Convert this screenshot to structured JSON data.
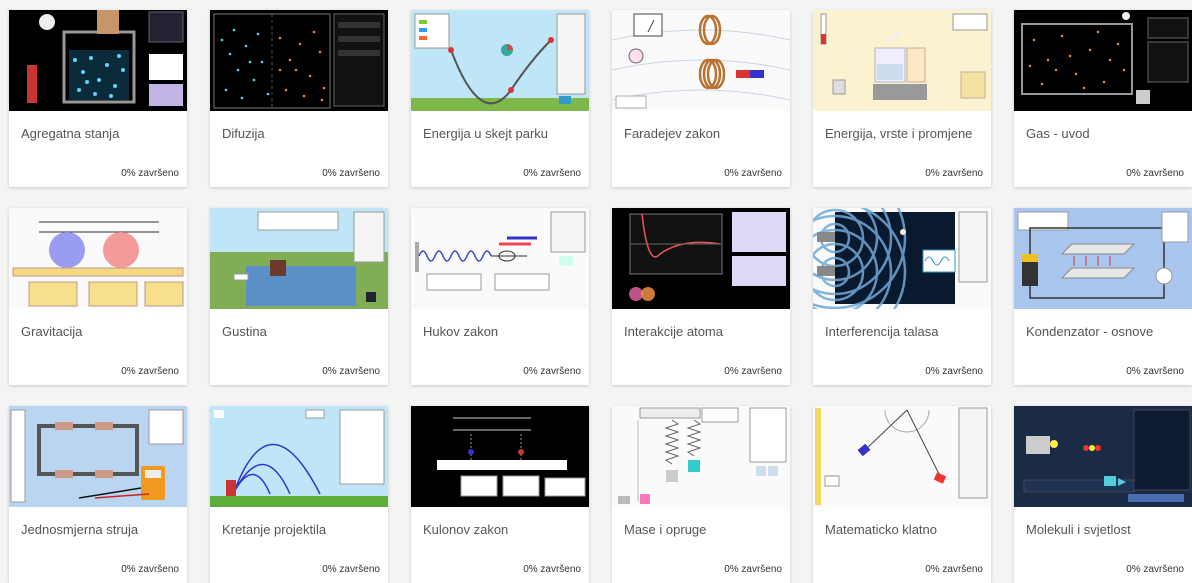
{
  "cards": [
    {
      "title": "Agregatna stanja",
      "progress": "0% završeno",
      "thumb": "dark"
    },
    {
      "title": "Difuzija",
      "progress": "0% završeno",
      "thumb": "dark"
    },
    {
      "title": "Energija u skejt parku",
      "progress": "0% završeno",
      "thumb": "sky"
    },
    {
      "title": "Faradejev zakon",
      "progress": "0% završeno",
      "thumb": "white"
    },
    {
      "title": "Energija, vrste i promjene",
      "progress": "0% završeno",
      "thumb": "cream"
    },
    {
      "title": "Gas - uvod",
      "progress": "0% završeno",
      "thumb": "dark"
    },
    {
      "title": "Gravitacija",
      "progress": "0% završeno",
      "thumb": "white"
    },
    {
      "title": "Gustina",
      "progress": "0% završeno",
      "thumb": "sky"
    },
    {
      "title": "Hukov zakon",
      "progress": "0% završeno",
      "thumb": "white"
    },
    {
      "title": "Interakcije atoma",
      "progress": "0% završeno",
      "thumb": "dark"
    },
    {
      "title": "Interferencija talasa",
      "progress": "0% završeno",
      "thumb": "white"
    },
    {
      "title": "Kondenzator - osnove",
      "progress": "0% završeno",
      "thumb": "blue"
    },
    {
      "title": "Jednosmjerna struja",
      "progress": "0% završeno",
      "thumb": "lblue"
    },
    {
      "title": "Kretanje projektila",
      "progress": "0% završeno",
      "thumb": "sky"
    },
    {
      "title": "Kulonov zakon",
      "progress": "0% završeno",
      "thumb": "dark"
    },
    {
      "title": "Mase i opruge",
      "progress": "0% završeno",
      "thumb": "white"
    },
    {
      "title": "Matematicko klatno",
      "progress": "0% završeno",
      "thumb": "white"
    },
    {
      "title": "Molekuli i svjetlost",
      "progress": "0% završeno",
      "thumb": "navy"
    }
  ]
}
